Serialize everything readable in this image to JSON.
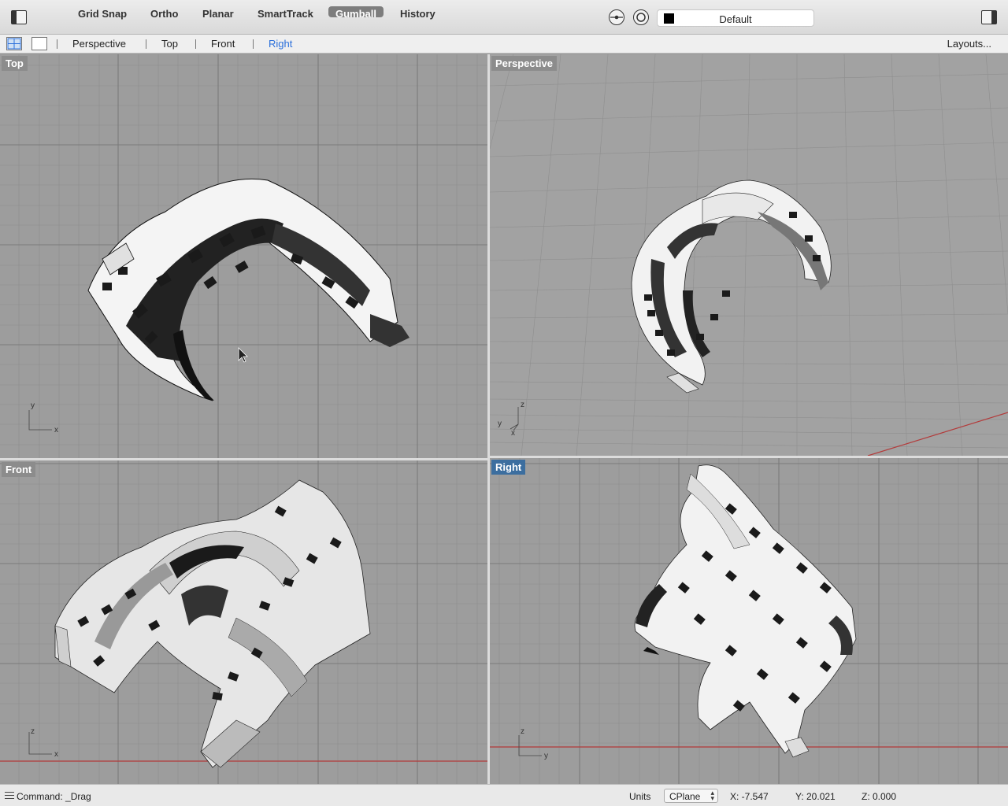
{
  "toolbar": {
    "grid_snap": "Grid Snap",
    "ortho": "Ortho",
    "planar": "Planar",
    "smarttrack": "SmartTrack",
    "gumball": "Gumball",
    "history": "History",
    "layer": "Default"
  },
  "tabs": {
    "perspective": "Perspective",
    "top": "Top",
    "front": "Front",
    "right": "Right",
    "layouts": "Layouts..."
  },
  "viewports": {
    "top": "Top",
    "perspective": "Perspective",
    "front": "Front",
    "right": "Right"
  },
  "axes": {
    "x": "x",
    "y": "y",
    "z": "z"
  },
  "statusbar": {
    "command": "Command: _Drag",
    "units": "Units",
    "cplane": "CPlane",
    "x": "X: -7.547",
    "y": "Y: 20.021",
    "z": "Z: 0.000"
  },
  "colors": {
    "active_tab": "#2a6fdb",
    "active_viewport_label": "#3c6e9f",
    "axis_red": "#b33a3a",
    "gumball_active": "#7d7d7d"
  }
}
